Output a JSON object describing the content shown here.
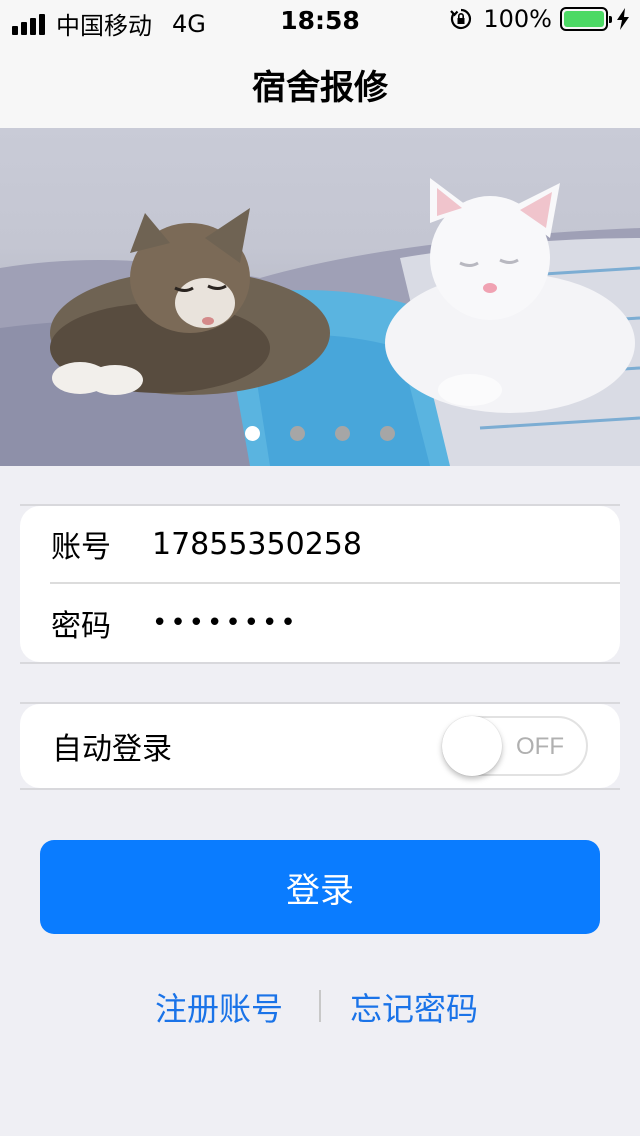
{
  "status_bar": {
    "carrier": "中国移动",
    "network": "4G",
    "time": "18:58",
    "battery": "100%",
    "battery_color": "#4cd964"
  },
  "nav": {
    "title": "宿舍报修"
  },
  "banner": {
    "slide_count": 4,
    "active_index": 0,
    "alt": "two kittens sleeping on a bed"
  },
  "login_form": {
    "account_label": "账号",
    "account_value": "17855350258",
    "password_label": "密码",
    "password_value": "••••••••"
  },
  "auto_login": {
    "label": "自动登录",
    "toggle_state": "OFF"
  },
  "login_button": {
    "label": "登录",
    "color": "#0a7cff"
  },
  "footer_links": {
    "register": "注册账号",
    "forgot": "忘记密码",
    "link_color": "#1a73e8"
  }
}
